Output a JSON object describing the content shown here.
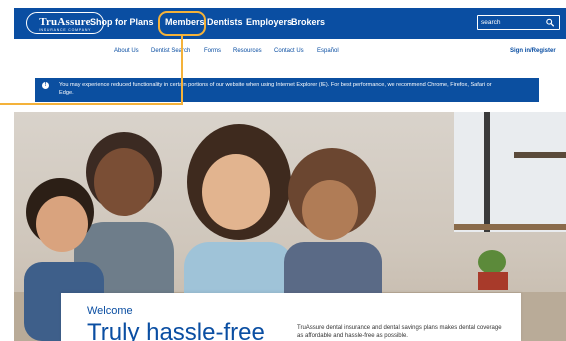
{
  "colors": {
    "brand": "#0a4ea2",
    "highlight": "#f4b23a",
    "alert_bg": "#0b4fa0"
  },
  "logo": {
    "name": "TruAssure",
    "tagline": "INSURANCE COMPANY"
  },
  "topnav": {
    "items": [
      {
        "label": "Shop for Plans"
      },
      {
        "label": "Members"
      },
      {
        "label": "Dentists"
      },
      {
        "label": "Employers"
      },
      {
        "label": "Brokers"
      }
    ],
    "search": {
      "placeholder": "search",
      "icon": "search-icon"
    }
  },
  "subnav": {
    "items": [
      {
        "label": "About Us"
      },
      {
        "label": "Dentist Search"
      },
      {
        "label": "Forms"
      },
      {
        "label": "Resources"
      },
      {
        "label": "Contact Us"
      },
      {
        "label": "Español"
      }
    ],
    "signin": "Sign in/Register"
  },
  "alert": {
    "icon": "info-icon",
    "text": "You may experience reduced functionality in certain portions of our website when using Internet Explorer (IE). For best performance, we recommend Chrome, Firefox, Safari or Edge."
  },
  "hero": {
    "image": "family-photo"
  },
  "welcome": {
    "label": "Welcome",
    "headline": "Truly hassle-free",
    "blurb": "TruAssure dental insurance and dental savings plans makes dental coverage as affordable and hassle-free as possible."
  }
}
